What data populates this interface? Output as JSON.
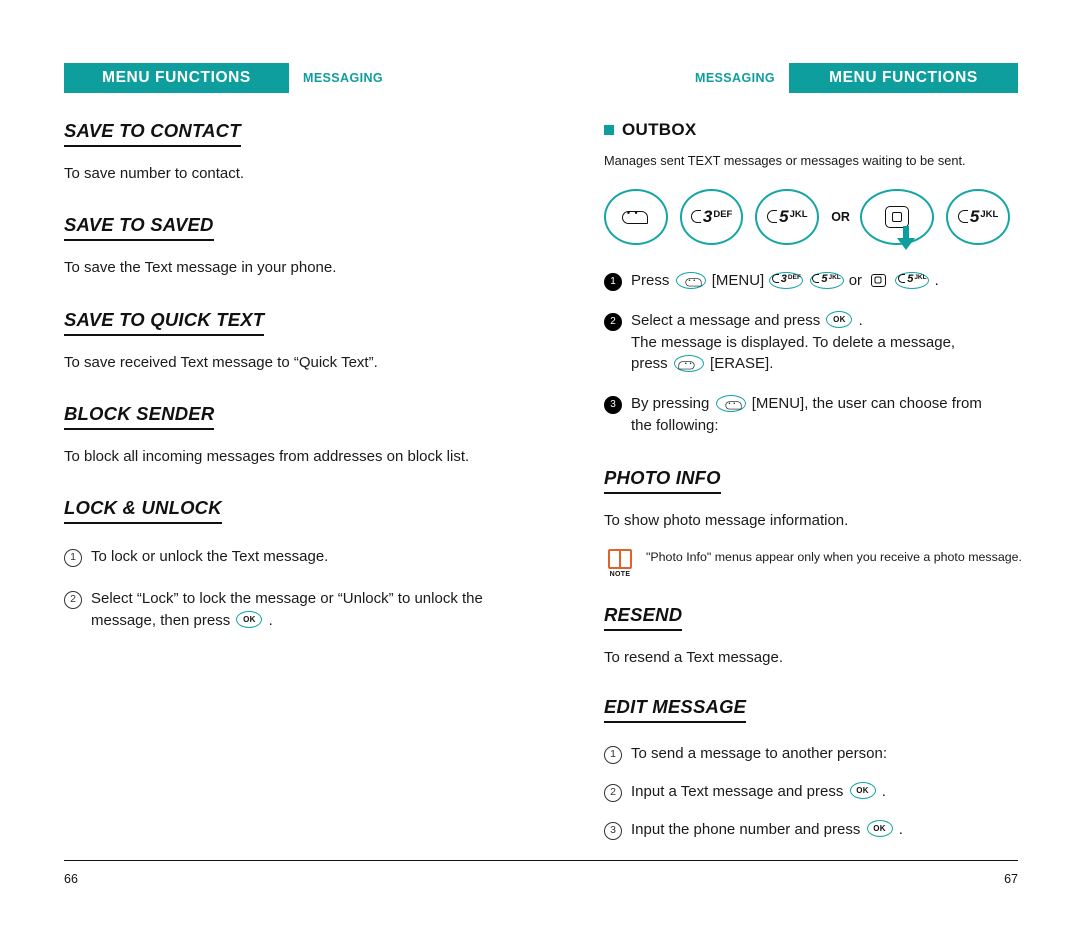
{
  "left_page": {
    "header": {
      "band": "MENU FUNCTIONS",
      "sub": "MESSAGING"
    },
    "sections": [
      {
        "title": "SAVE TO CONTACT",
        "body": "To save number to contact."
      },
      {
        "title": "SAVE TO SAVED",
        "body": "To save the Text message in your phone."
      },
      {
        "title": "SAVE TO QUICK TEXT",
        "body": "To save received Text message to “Quick Text”."
      },
      {
        "title": "BLOCK SENDER",
        "body": "To block all incoming messages from addresses on block list."
      },
      {
        "title": "LOCK & UNLOCK",
        "body": ""
      }
    ],
    "lock_steps": [
      {
        "num": "1",
        "text": "To lock or unlock the Text message."
      },
      {
        "num": "2",
        "text_before": "Select “Lock” to lock the message or “Unlock” to unlock the message, then press",
        "key": "ok-key",
        "text_after": "."
      }
    ],
    "page_number": "66"
  },
  "right_page": {
    "header": {
      "band": "MENU FUNCTIONS",
      "sub": "MESSAGING"
    },
    "outbox": {
      "title": "OUTBOX",
      "description": "Manages sent TEXT messages or messages waiting to be sent."
    },
    "key_graphics": {
      "keys": [
        {
          "name": "menu-key",
          "label": ""
        },
        {
          "name": "key-3",
          "digit": "3",
          "letters": "DEF"
        },
        {
          "name": "key-5",
          "digit": "5",
          "letters": "JKL"
        }
      ],
      "or_label": "OR",
      "alt_keys": [
        {
          "name": "nav-key",
          "label": ""
        },
        {
          "name": "key-5",
          "digit": "5",
          "letters": "JKL"
        }
      ]
    },
    "steps": [
      {
        "num": "1",
        "text_before": "Press",
        "menu_label": "[MENU]",
        "mid": "or",
        "text_after": "."
      },
      {
        "num": "2",
        "text_before": "Select a message and press",
        "text_after": ".",
        "detail1": "The message is displayed. To delete a message,",
        "detail2_before": "press",
        "detail2_after": "[ERASE]."
      },
      {
        "num": "3",
        "text_before": "By pressing",
        "menu_label": "[MENU], the user can choose from",
        "text_after": "the following:"
      }
    ],
    "sections": [
      {
        "title": "PHOTO INFO",
        "body": "To show photo message information."
      },
      {
        "title": "RESEND",
        "body": "To resend a Text message."
      },
      {
        "title": "EDIT MESSAGE",
        "body": ""
      }
    ],
    "note": {
      "label": "NOTE",
      "text": "\"Photo Info\" menus appear only when you receive a photo message."
    },
    "edit_steps": [
      {
        "num": "1",
        "text": "To send a message to another person:"
      },
      {
        "num": "2",
        "text_before": "Input a Text message and press",
        "text_after": "."
      },
      {
        "num": "3",
        "text_before": "Input the phone number and press",
        "text_after": "."
      }
    ],
    "page_number": "67"
  }
}
